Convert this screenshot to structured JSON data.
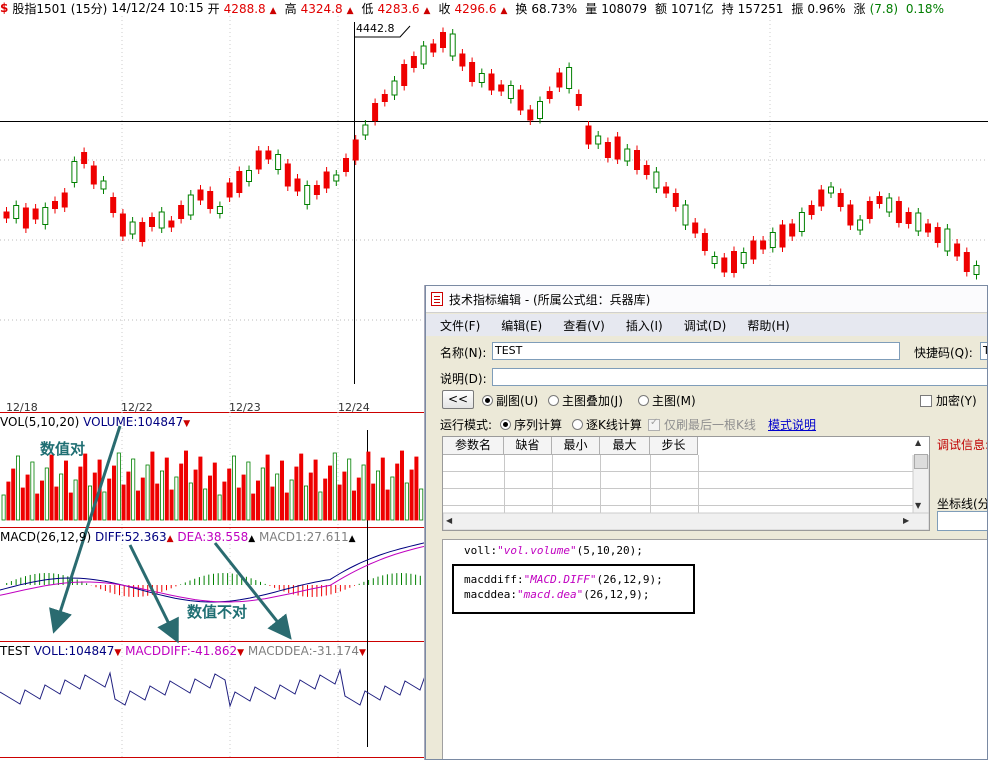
{
  "info": {
    "icon": "$",
    "name": "股指1501 (15分)",
    "datetime": "14/12/24 10:15",
    "open_label": "开",
    "open": "4288.8",
    "high_label": "高",
    "high": "4324.8",
    "low_label": "低",
    "low": "4283.6",
    "close_label": "收",
    "close": "4296.6",
    "turnover_label": "换",
    "turnover": "68.73%",
    "volume_label": "量",
    "volume": "108079",
    "amount_label": "额",
    "amount": "1071亿",
    "oi_label": "持",
    "oi": "157251",
    "amp_label": "振",
    "amp": "0.96%",
    "chg_label": "涨",
    "chg": "(7.8)",
    "chg_pct": "0.18%"
  },
  "price_chart": {
    "peak_label": "4442.8",
    "dates": [
      "12/18",
      "12/22",
      "12/23",
      "12/24"
    ]
  },
  "vol_pane": {
    "title": "VOL(5,10,20)",
    "volume_text": "VOLUME:104847"
  },
  "macd_pane": {
    "title": "MACD(26,12,9)",
    "diff": "DIFF:52.363",
    "dea": "DEA:38.558",
    "macd": "MACD1:27.611"
  },
  "test_pane": {
    "title": "TEST",
    "voll": "VOLL:104847",
    "macddiff": "MACDDIFF:-41.862",
    "macddea": "MACDDEA:-31.174"
  },
  "annotations": {
    "correct": "数值对",
    "wrong": "数值不对"
  },
  "dialog": {
    "title": "技术指标编辑 - (所属公式组：兵器库)",
    "menu": [
      "文件(F)",
      "编辑(E)",
      "查看(V)",
      "插入(I)",
      "调试(D)",
      "帮助(H)"
    ],
    "name_label": "名称(N):",
    "name_value": "TEST",
    "shortcut_label": "快捷码(Q):",
    "shortcut_value": "T",
    "desc_label": "说明(D):",
    "back_button": "<<",
    "opt_sub": "副图(U)",
    "opt_overlay": "主图叠加(J)",
    "opt_main": "主图(M)",
    "encrypt": "加密(Y)",
    "run_mode_label": "运行模式:",
    "run_seq": "序列计算",
    "run_bar": "逐K线计算",
    "refresh_last": "仅刷最后一根K线",
    "mode_help": "模式说明",
    "param_headers": [
      "参数名",
      "缺省",
      "最小",
      "最大",
      "步长"
    ],
    "debug_info": "调试信息:",
    "axis_label": "坐标线(分",
    "code": {
      "line1_pre": "voll:",
      "line1_str": "\"vol.volume\"",
      "line1_post": "(5,10,20);",
      "line2_pre": "macddiff:",
      "line2_str": "\"MACD.DIFF\"",
      "line2_post": "(26,12,9);",
      "line3_pre": "macddea:",
      "line3_str": "\"macd.dea\"",
      "line3_post": "(26,12,9);"
    }
  }
}
